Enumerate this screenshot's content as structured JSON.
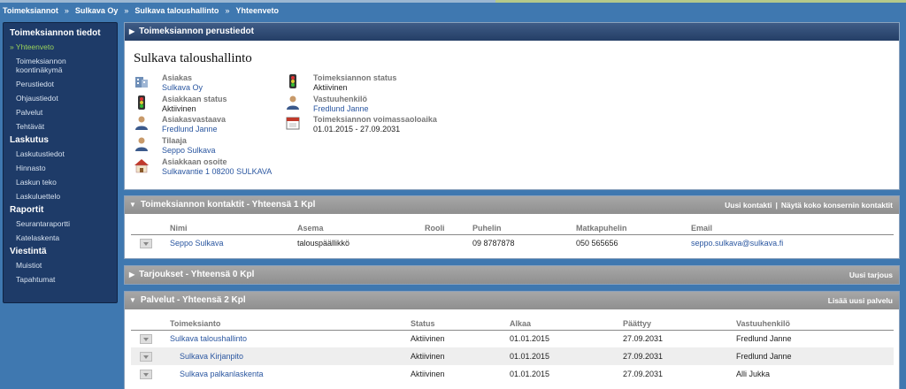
{
  "breadcrumb": [
    "Toimeksiannot",
    "Sulkava Oy",
    "Sulkava taloushallinto",
    "Yhteenveto"
  ],
  "breadcrumb_sep": "»",
  "sidebar": {
    "sections": [
      {
        "title": "Toimeksiannon tiedot",
        "items": [
          "» Yhteenveto",
          "Toimeksiannon koontinäkymä",
          "Perustiedot",
          "Ohjaustiedot",
          "Palvelut",
          "Tehtävät"
        ]
      },
      {
        "title": "Laskutus",
        "items": [
          "Laskutustiedot",
          "Hinnasto",
          "Laskun teko",
          "Laskuluettelo"
        ]
      },
      {
        "title": "Raportit",
        "items": [
          "Seurantaraportti",
          "Katelaskenta"
        ]
      },
      {
        "title": "Viestintä",
        "items": [
          "Muistiot",
          "Tapahtumat"
        ]
      }
    ]
  },
  "basic": {
    "header": "Toimeksiannon perustiedot",
    "title": "Sulkava taloushallinto",
    "left": [
      {
        "label": "Asiakas",
        "value": "Sulkava Oy",
        "icon": "building-icon",
        "link": true
      },
      {
        "label": "Asiakkaan status",
        "value": "Aktiivinen",
        "icon": "traffic-light-icon",
        "link": false
      },
      {
        "label": "Asiakasvastaava",
        "value": "Fredlund Janne",
        "icon": "person-icon",
        "link": true
      },
      {
        "label": "Tilaaja",
        "value": "Seppo Sulkava",
        "icon": "person-icon",
        "link": true
      },
      {
        "label": "Asiakkaan osoite",
        "value": "Sulkavantie 1 08200 SULKAVA",
        "icon": "house-icon",
        "link": true
      }
    ],
    "right": [
      {
        "label": "Toimeksiannon status",
        "value": "Aktiivinen",
        "icon": "traffic-light-icon",
        "link": false
      },
      {
        "label": "Vastuuhenkilö",
        "value": "Fredlund Janne",
        "icon": "person-icon",
        "link": true
      },
      {
        "label": "Toimeksiannon voimassaoloaika",
        "value": "01.01.2015 - 27.09.2031",
        "icon": "calendar-icon",
        "link": false
      }
    ]
  },
  "contacts": {
    "header": "Toimeksiannon kontaktit - Yhteensä 1 Kpl",
    "link1": "Uusi kontakti",
    "link_sep": "|",
    "link2": "Näytä koko konsernin kontaktit",
    "columns": [
      "Nimi",
      "Asema",
      "Rooli",
      "Puhelin",
      "Matkapuhelin",
      "Email"
    ],
    "rows": [
      [
        "Seppo Sulkava",
        "talouspäällikkö",
        "",
        "09 8787878",
        "050 565656",
        "seppo.sulkava@sulkava.fi"
      ]
    ]
  },
  "offers": {
    "header": "Tarjoukset - Yhteensä 0 Kpl",
    "link1": "Uusi tarjous"
  },
  "services": {
    "header": "Palvelut - Yhteensä 2 Kpl",
    "link1": "Lisää uusi palvelu",
    "columns": [
      "Toimeksianto",
      "Status",
      "Alkaa",
      "Päättyy",
      "Vastuuhenkilö"
    ],
    "rows": [
      [
        "Sulkava taloushallinto",
        "Aktiivinen",
        "01.01.2015",
        "27.09.2031",
        "Fredlund Janne"
      ],
      [
        "Sulkava Kirjanpito",
        "Aktiivinen",
        "01.01.2015",
        "27.09.2031",
        "Fredlund Janne"
      ],
      [
        "Sulkava palkanlaskenta",
        "Aktiivinen",
        "01.01.2015",
        "27.09.2031",
        "Alli Jukka"
      ]
    ]
  }
}
